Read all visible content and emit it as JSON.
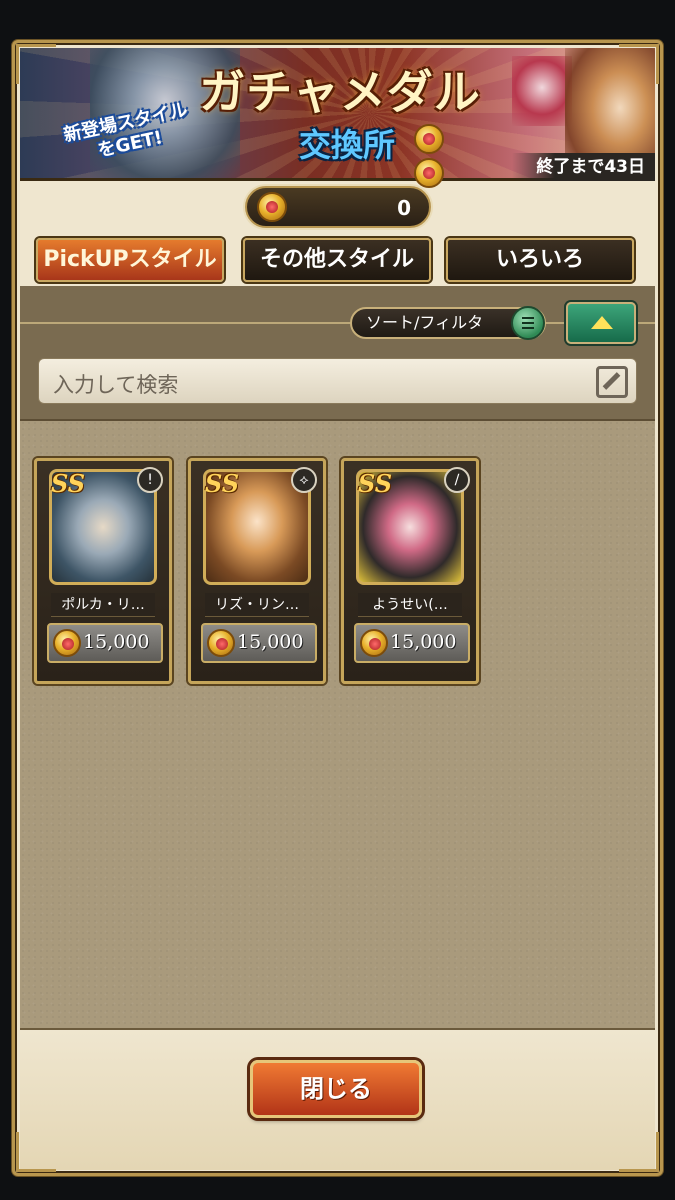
{
  "banner": {
    "title": "ガチャメダル",
    "subtitle": "交換所",
    "tagline_line1": "新登場スタイル",
    "tagline_line2": "をGET!",
    "remaining": "終了まで43日"
  },
  "currency": {
    "value": "0",
    "icon": "gacha-medal-icon"
  },
  "tabs": [
    {
      "label": "PickUPスタイル",
      "active": true
    },
    {
      "label": "その他スタイル",
      "active": false
    },
    {
      "label": "いろいろ",
      "active": false
    }
  ],
  "toolbar": {
    "sort_label": "ソート/フィルタ"
  },
  "search": {
    "placeholder": "入力して検索"
  },
  "items": [
    {
      "name": "ポルカ・リ…",
      "price": "15,000",
      "weapon_icon": "!"
    },
    {
      "name": "リズ・リン…",
      "price": "15,000",
      "weapon_icon": "⟡"
    },
    {
      "name": "ようせい(…",
      "price": "15,000",
      "weapon_icon": "∕"
    }
  ],
  "footer": {
    "close_label": "閉じる"
  },
  "colors": {
    "accent": "#e57b2d",
    "gold": "#c5a55a",
    "panel": "#a99a7c"
  }
}
